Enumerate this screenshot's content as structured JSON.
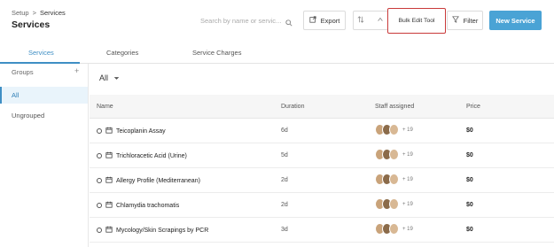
{
  "breadcrumb": {
    "parent": "Setup",
    "separator": ">",
    "current": "Services"
  },
  "page_title": "Services",
  "search": {
    "placeholder": "Search by name or servic..."
  },
  "toolbar": {
    "export_label": "Export",
    "bulk_edit_label": "Bulk Edit Tool",
    "filter_label": "Filter",
    "new_label": "New Service"
  },
  "tabs": [
    {
      "label": "Services",
      "active": true
    },
    {
      "label": "Categories",
      "active": false
    },
    {
      "label": "Service Charges",
      "active": false
    }
  ],
  "sidebar": {
    "groups_label": "Groups",
    "add_symbol": "+",
    "items": [
      {
        "label": "All",
        "active": true
      },
      {
        "label": "Ungrouped",
        "active": false
      }
    ]
  },
  "filter": {
    "selected": "All"
  },
  "table": {
    "columns": [
      "Name",
      "Duration",
      "Staff assigned",
      "Price"
    ],
    "rows": [
      {
        "name": "Teicoplanin Assay",
        "duration": "6d",
        "staff_more": "+ 19",
        "price": "$0"
      },
      {
        "name": "Trichloracetic Acid (Urine)",
        "duration": "5d",
        "staff_more": "+ 19",
        "price": "$0"
      },
      {
        "name": "Allergy Profile (Mediterranean)",
        "duration": "2d",
        "staff_more": "+ 19",
        "price": "$0"
      },
      {
        "name": "Chlamydia trachomatis",
        "duration": "2d",
        "staff_more": "+ 19",
        "price": "$0"
      },
      {
        "name": "Mycology/Skin Scrapings by PCR",
        "duration": "3d",
        "staff_more": "+ 19",
        "price": "$0"
      }
    ]
  },
  "colors": {
    "accent": "#4aa3d5",
    "active_tab": "#3f8fc4",
    "highlight_border": "#c93a3a"
  }
}
